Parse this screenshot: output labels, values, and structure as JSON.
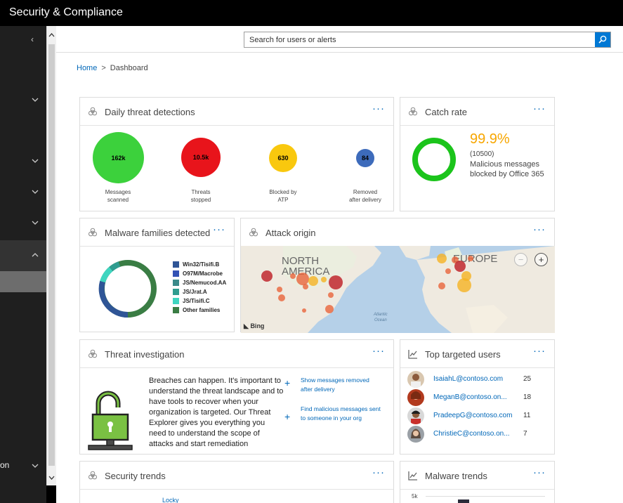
{
  "app": {
    "title": "Security & Compliance"
  },
  "sidebar": {
    "partial_label": "on"
  },
  "search": {
    "placeholder": "Search for users or alerts"
  },
  "breadcrumb": {
    "home": "Home",
    "separator": ">",
    "current": "Dashboard"
  },
  "more_label": "···",
  "daily_threats": {
    "title": "Daily threat detections",
    "items": [
      {
        "value": "162k",
        "label_1": "Messages",
        "label_2": "scanned",
        "color": "#3cd13c"
      },
      {
        "value": "10.5k",
        "label_1": "Threats",
        "label_2": "stopped",
        "color": "#e8141b"
      },
      {
        "value": "630",
        "label_1": "Blocked by",
        "label_2": "ATP",
        "color": "#f9c80e"
      },
      {
        "value": "84",
        "label_1": "Removed",
        "label_2": "after delivery",
        "color": "#3d6bbb"
      }
    ]
  },
  "catch_rate": {
    "title": "Catch rate",
    "percent": "99.9%",
    "percent_value": 99.9,
    "count": "(10500)",
    "description": "Malicious messages blocked by Office 365",
    "ring_color": "#1bc41b",
    "percent_color": "#f7a600"
  },
  "malware_families": {
    "title": "Malware families detected",
    "legend": [
      {
        "name": "Win32/Tisifi.B",
        "color": "#2f5596"
      },
      {
        "name": "O97M/Macrobe",
        "color": "#3352b5"
      },
      {
        "name": "JS/Nemucod.AA",
        "color": "#3a8a8a"
      },
      {
        "name": "JS/Jrat.A",
        "color": "#2f9c8f"
      },
      {
        "name": "JS/Tisifi.C",
        "color": "#3fd5c0"
      },
      {
        "name": "Other families",
        "color": "#3a7d44"
      }
    ]
  },
  "attack_origin": {
    "title": "Attack origin",
    "map_label_america_1": "NORTH",
    "map_label_america_2": "AMERICA",
    "map_label_europe": "EUROPE",
    "ocean_1": "Atlantic",
    "ocean_2": "Ocean",
    "map_provider": "Bing",
    "zoom_out": "−",
    "zoom_in": "+"
  },
  "threat_investigation": {
    "title": "Threat investigation",
    "text": "Breaches can happen. It's important to understand the threat landscape and to have tools to recover when your organization is targeted. Our Threat Explorer gives you everything you need to understand the scope of attacks and start remediation",
    "plus": "+",
    "links": [
      "Show messages removed after delivery",
      "Find malicious messages sent to someone in your org"
    ]
  },
  "top_users": {
    "title": "Top targeted users",
    "users": [
      {
        "email": "IsaiahL@contoso.com",
        "count": "25"
      },
      {
        "email": "MeganB@contoso.on...",
        "count": "18"
      },
      {
        "email": "PradeepG@contoso.com",
        "count": "11"
      },
      {
        "email": "ChristieC@contoso.on...",
        "count": "7"
      }
    ]
  },
  "security_trends": {
    "title": "Security trends",
    "partial_item": "Locky"
  },
  "malware_trends": {
    "title": "Malware trends",
    "axis_value": "5k"
  }
}
